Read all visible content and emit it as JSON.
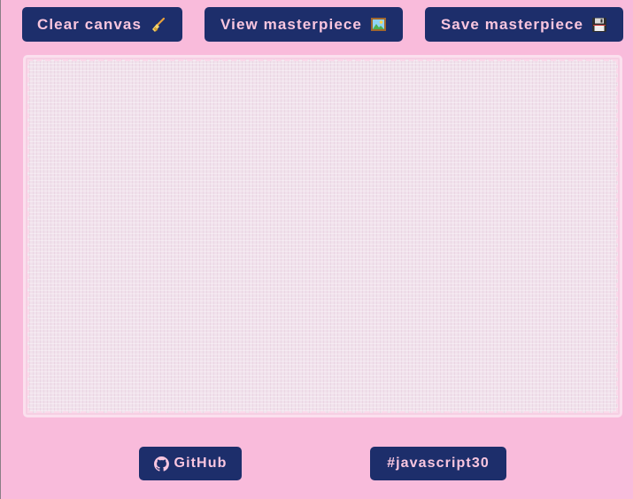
{
  "toolbar": {
    "clear_label": "Clear canvas",
    "clear_icon": "broom-icon",
    "view_label": "View masterpiece",
    "view_icon": "framed-picture-icon",
    "save_label": "Save masterpiece",
    "save_icon": "floppy-disk-icon"
  },
  "footer": {
    "github_label": "GitHub",
    "github_icon": "github-icon",
    "hashtag_label": "#javascript30"
  },
  "colors": {
    "background": "#f9bbdb",
    "button": "#1d2e6b",
    "button_text": "#f9c6df",
    "canvas": "#f1e2ec"
  }
}
